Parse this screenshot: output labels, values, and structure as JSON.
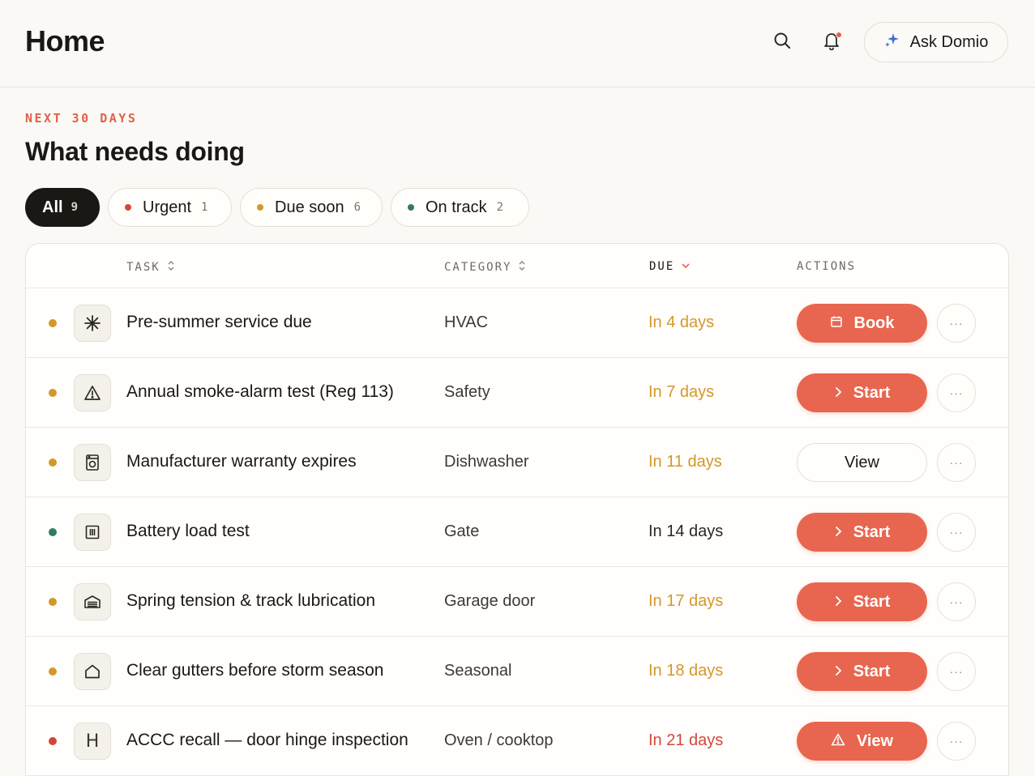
{
  "header": {
    "title": "Home",
    "ask_label": "Ask Domio"
  },
  "section": {
    "eyebrow": "NEXT 30 DAYS",
    "title": "What needs doing"
  },
  "filters": [
    {
      "label": "All",
      "count": "9"
    },
    {
      "label": "Urgent",
      "count": "1",
      "color": "#d2473a"
    },
    {
      "label": "Due soon",
      "count": "6",
      "color": "#d4972a"
    },
    {
      "label": "On track",
      "count": "2",
      "color": "#2e7d5e"
    }
  ],
  "columns": {
    "task": "TASK",
    "category": "CATEGORY",
    "due": "DUE",
    "actions": "ACTIONS"
  },
  "status_colors": {
    "soon": "#d4972a",
    "ok": "#2e7d5e",
    "urgent": "#d2473a"
  },
  "rows": [
    {
      "task": "Pre-summer service due",
      "category": "HVAC",
      "due": "In 4 days",
      "status": "soon",
      "icon": "snowflake-icon",
      "action": "Book",
      "action_icon": "calendar-icon"
    },
    {
      "task": "Annual smoke-alarm test (Reg 113)",
      "category": "Safety",
      "due": "In 7 days",
      "status": "soon",
      "icon": "warning-icon",
      "action": "Start",
      "action_icon": "chevron-right-icon"
    },
    {
      "task": "Manufacturer warranty expires",
      "category": "Dishwasher",
      "due": "In 11 days",
      "status": "soon",
      "icon": "dishwasher-icon",
      "action": "View",
      "action_icon": ""
    },
    {
      "task": "Battery load test",
      "category": "Gate",
      "due": "In 14 days",
      "status": "ok",
      "icon": "gate-icon",
      "action": "Start",
      "action_icon": "chevron-right-icon"
    },
    {
      "task": "Spring tension & track lubrication",
      "category": "Garage door",
      "due": "In 17 days",
      "status": "soon",
      "icon": "garage-icon",
      "action": "Start",
      "action_icon": "chevron-right-icon"
    },
    {
      "task": "Clear gutters before storm season",
      "category": "Seasonal",
      "due": "In 18 days",
      "status": "soon",
      "icon": "house-icon",
      "action": "Start",
      "action_icon": "chevron-right-icon"
    },
    {
      "task": "ACCC recall — door hinge inspection",
      "category": "Oven / cooktop",
      "due": "In 21 days",
      "status": "urgent",
      "icon": "letter-h-icon",
      "icon_text": "H",
      "action": "View",
      "action_icon": "warning-icon"
    }
  ],
  "more_glyph": "···"
}
